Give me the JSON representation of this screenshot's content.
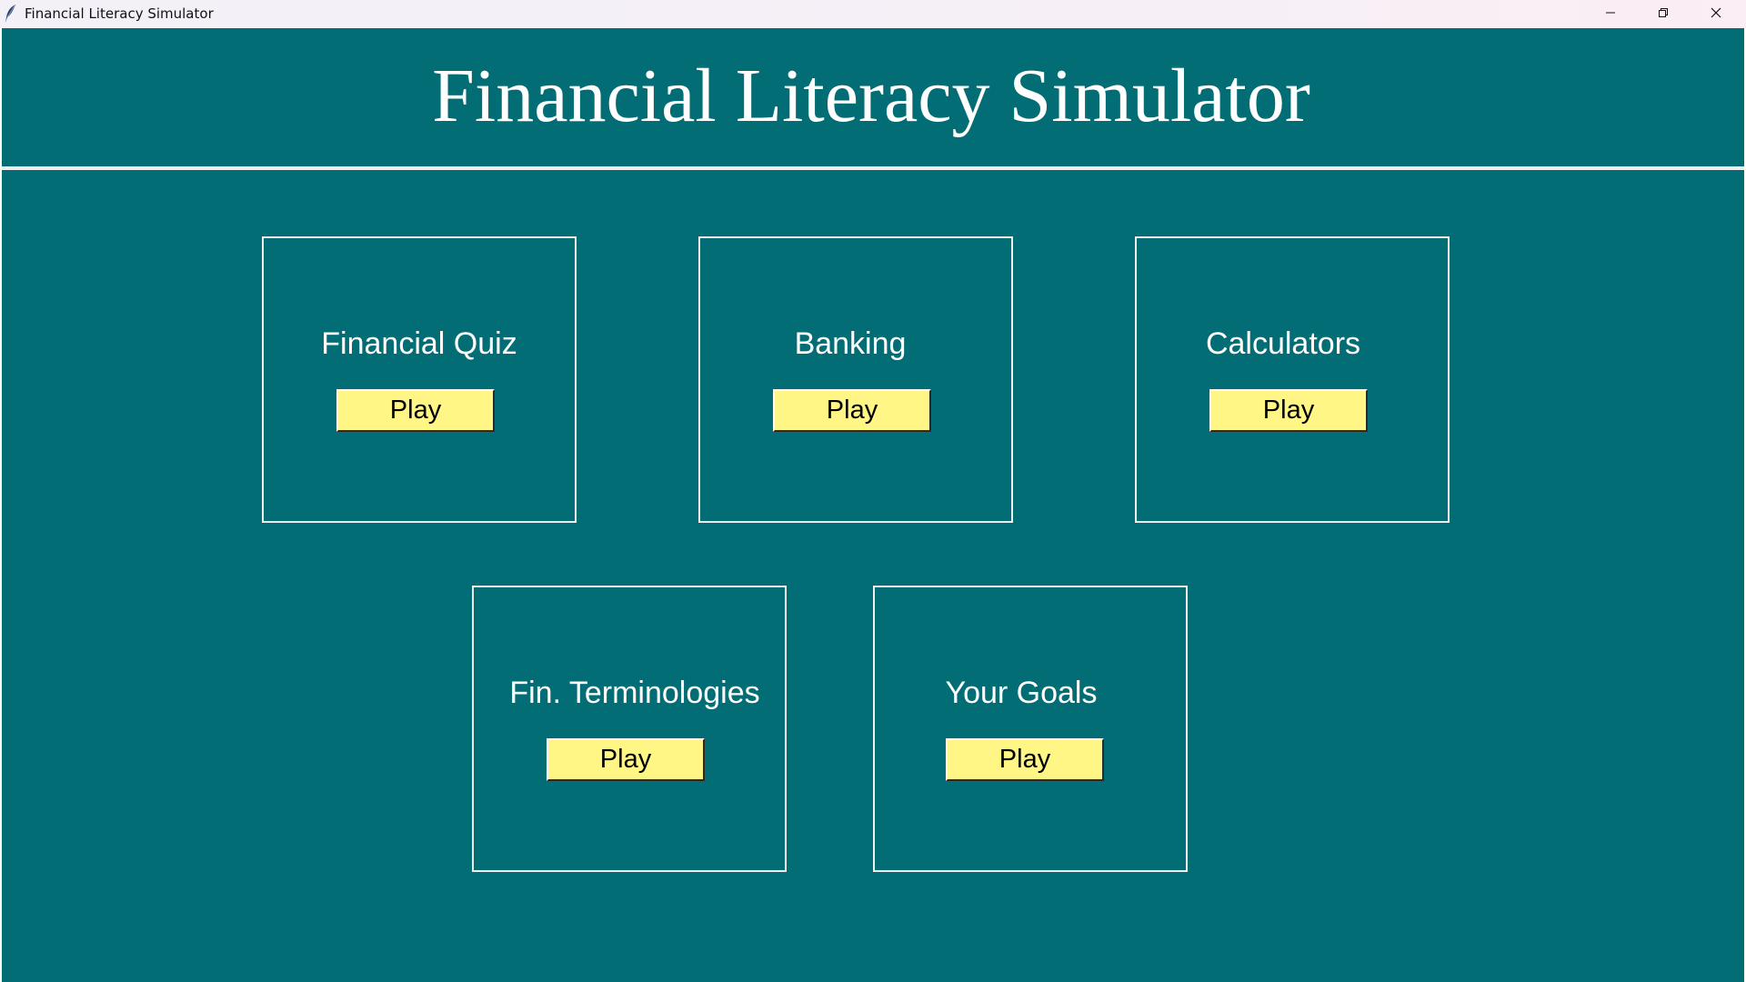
{
  "window": {
    "title": "Financial Literacy Simulator",
    "icon": "feather-icon",
    "controls": [
      "minimize-icon",
      "restore-icon",
      "close-icon"
    ]
  },
  "header": {
    "title": "Financial Literacy Simulator"
  },
  "cards": [
    {
      "label": "Financial Quiz",
      "button": "Play"
    },
    {
      "label": "Banking",
      "button": "Play"
    },
    {
      "label": "Calculators",
      "button": "Play"
    },
    {
      "label": "Fin. Terminologies",
      "button": "Play"
    },
    {
      "label": "Your Goals",
      "button": "Play"
    }
  ],
  "colors": {
    "background": "#036d75",
    "button": "#fff685",
    "border": "#f0f0f0",
    "text": "#ffffff"
  }
}
